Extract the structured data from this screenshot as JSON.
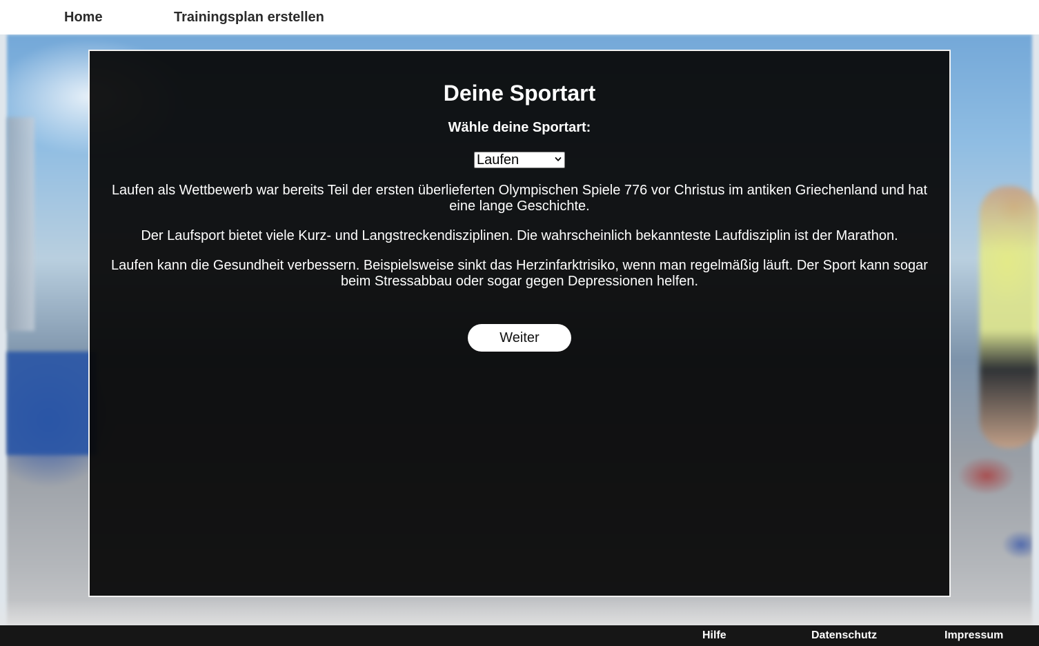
{
  "nav": {
    "home": "Home",
    "create_plan": "Trainingsplan erstellen"
  },
  "main": {
    "title": "Deine Sportart",
    "choose_label": "Wähle deine Sportart:",
    "sport_select": {
      "selected": "Laufen"
    },
    "paragraphs": [
      "Laufen als Wettbewerb war bereits Teil der ersten überlieferten Olympischen Spiele 776 vor Christus im antiken Griechenland und hat eine lange Geschichte.",
      "Der Laufsport bietet viele Kurz- und Langstreckendisziplinen. Die wahrscheinlich bekannteste Laufdisziplin ist der Marathon.",
      "Laufen kann die Gesundheit verbessern. Beispielsweise sinkt das Herzinfarktrisiko, wenn man regelmäßig läuft. Der Sport kann sogar beim Stressabbau oder sogar gegen Depressionen helfen."
    ],
    "next_button": "Weiter"
  },
  "footer": {
    "help": "Hilfe",
    "privacy": "Datenschutz",
    "imprint": "Impressum"
  },
  "colors": {
    "panel_background": "#080808",
    "panel_border": "#f2f2f2",
    "footer_background": "#161616",
    "nav_text": "#2b2b2b"
  },
  "icons": {
    "select_arrow": "chevron-down-icon"
  }
}
